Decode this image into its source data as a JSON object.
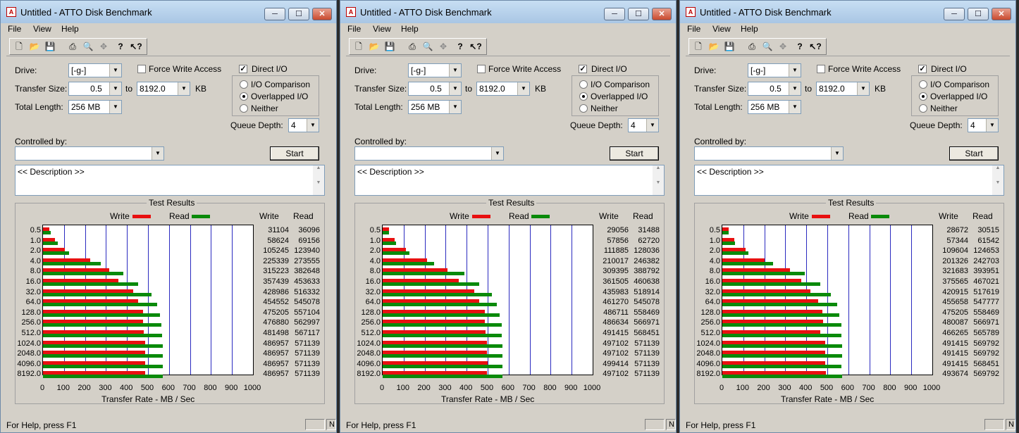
{
  "app": {
    "title": "Untitled - ATTO Disk Benchmark",
    "caption_buttons": {
      "minimize": "─",
      "maximize": "☐",
      "close": "✕"
    },
    "menu": [
      "File",
      "View",
      "Help"
    ],
    "status_text": "For Help, press F1",
    "status_pane_text": "N"
  },
  "form": {
    "drive_label": "Drive:",
    "drive_value": "[-g-]",
    "force_write_label": "Force Write Access",
    "direct_io_label": "Direct I/O",
    "transfer_size_label": "Transfer Size:",
    "transfer_from": "0.5",
    "to_label": "to",
    "transfer_to": "8192.0",
    "kb_label": "KB",
    "total_length_label": "Total Length:",
    "total_length_value": "256 MB",
    "io_comparison_label": "I/O Comparison",
    "overlapped_io_label": "Overlapped I/O",
    "neither_label": "Neither",
    "queue_depth_label": "Queue Depth:",
    "queue_depth_value": "4",
    "controlled_by_label": "Controlled by:",
    "controlled_by_value": "",
    "start_label": "Start",
    "description_text": "<< Description >>"
  },
  "results_labels": {
    "title": "Test Results",
    "write_legend": "Write",
    "read_legend": "Read",
    "write_col": "Write",
    "read_col": "Read",
    "x_axis_label": "Transfer Rate - MB / Sec"
  },
  "icons": [
    "new-icon",
    "open-icon",
    "save-icon",
    "print-icon",
    "print-preview-icon",
    "move-icon",
    "help-icon",
    "context-help-icon"
  ],
  "colors": {
    "write": "#e81010",
    "read": "#0a8a0a",
    "grid": "#2a2ac0"
  },
  "chart_data": [
    {
      "type": "bar",
      "orientation": "horizontal",
      "categories": [
        "0.5",
        "1.0",
        "2.0",
        "4.0",
        "8.0",
        "16.0",
        "32.0",
        "64.0",
        "128.0",
        "256.0",
        "512.0",
        "1024.0",
        "2048.0",
        "4096.0",
        "8192.0"
      ],
      "series": [
        {
          "name": "Write",
          "values": [
            31104,
            58624,
            105245,
            225339,
            315223,
            357439,
            428986,
            454552,
            475205,
            476880,
            481498,
            486957,
            486957,
            486957,
            486957
          ]
        },
        {
          "name": "Read",
          "values": [
            36096,
            69156,
            123940,
            273555,
            382648,
            453633,
            516332,
            545078,
            557104,
            562997,
            567117,
            571139,
            571139,
            571139,
            571139
          ]
        }
      ],
      "xlabel": "Transfer Rate - MB / Sec",
      "xlim": [
        0,
        1000
      ],
      "x_ticks": [
        0,
        100,
        200,
        300,
        400,
        500,
        600,
        700,
        800,
        900,
        1000
      ],
      "grid": true,
      "legend": "top"
    },
    {
      "type": "bar",
      "orientation": "horizontal",
      "categories": [
        "0.5",
        "1.0",
        "2.0",
        "4.0",
        "8.0",
        "16.0",
        "32.0",
        "64.0",
        "128.0",
        "256.0",
        "512.0",
        "1024.0",
        "2048.0",
        "4096.0",
        "8192.0"
      ],
      "series": [
        {
          "name": "Write",
          "values": [
            29056,
            57856,
            111885,
            210017,
            309395,
            361505,
            435983,
            461270,
            486711,
            486634,
            491415,
            497102,
            497102,
            499414,
            497102
          ]
        },
        {
          "name": "Read",
          "values": [
            31488,
            62720,
            128036,
            246382,
            388792,
            460638,
            518914,
            545078,
            558469,
            566971,
            568451,
            571139,
            571139,
            571139,
            571139
          ]
        }
      ],
      "xlabel": "Transfer Rate - MB / Sec",
      "xlim": [
        0,
        1000
      ],
      "x_ticks": [
        0,
        100,
        200,
        300,
        400,
        500,
        600,
        700,
        800,
        900,
        1000
      ],
      "grid": true,
      "legend": "top"
    },
    {
      "type": "bar",
      "orientation": "horizontal",
      "categories": [
        "0.5",
        "1.0",
        "2.0",
        "4.0",
        "8.0",
        "16.0",
        "32.0",
        "64.0",
        "128.0",
        "256.0",
        "512.0",
        "1024.0",
        "2048.0",
        "4096.0",
        "8192.0"
      ],
      "series": [
        {
          "name": "Write",
          "values": [
            28672,
            57344,
            109604,
            201326,
            321683,
            375565,
            420915,
            455658,
            475205,
            480087,
            466265,
            491415,
            491415,
            491415,
            493674
          ]
        },
        {
          "name": "Read",
          "values": [
            30515,
            61542,
            124653,
            242703,
            393951,
            467021,
            517619,
            547777,
            558469,
            566971,
            565789,
            569792,
            569792,
            568451,
            569792
          ]
        }
      ],
      "xlabel": "Transfer Rate - MB / Sec",
      "xlim": [
        0,
        1000
      ],
      "x_ticks": [
        0,
        100,
        200,
        300,
        400,
        500,
        600,
        700,
        800,
        900,
        1000
      ],
      "grid": true,
      "legend": "top"
    }
  ]
}
